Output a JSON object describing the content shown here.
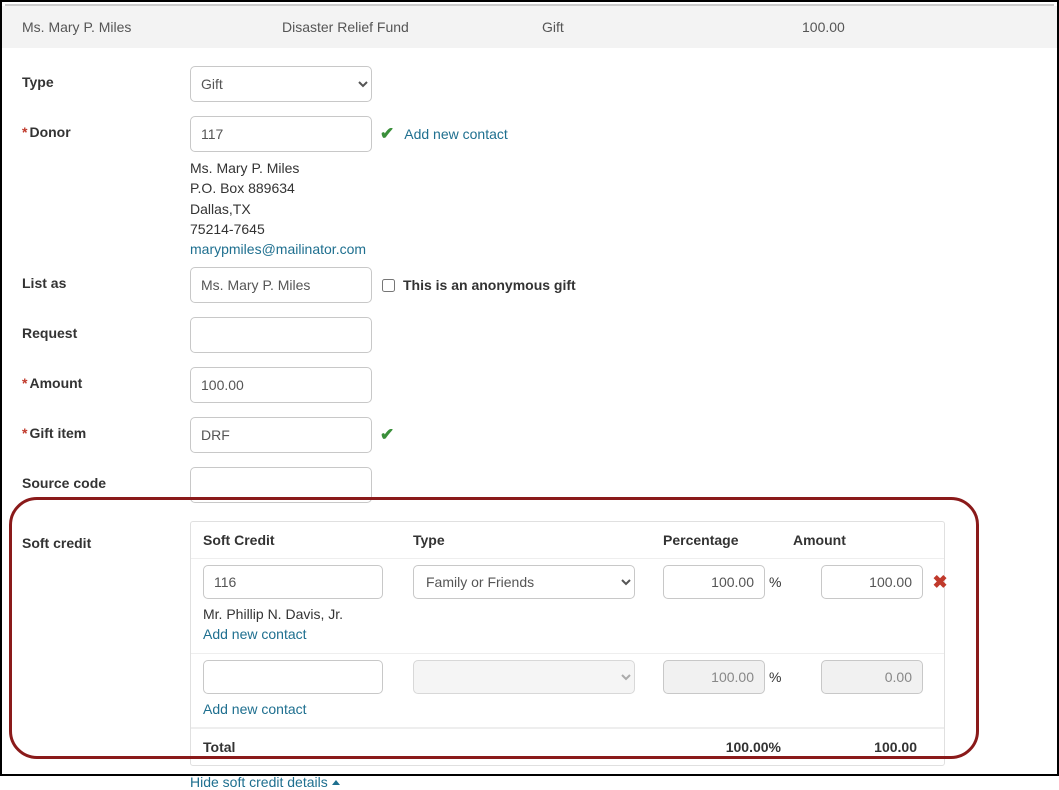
{
  "summary": {
    "name": "Ms. Mary P. Miles",
    "fund": "Disaster Relief Fund",
    "kind": "Gift",
    "amount": "100.00"
  },
  "labels": {
    "type": "Type",
    "donor": "Donor",
    "addContact": "Add new contact",
    "listAs": "List as",
    "anon": "This is an anonymous gift",
    "request": "Request",
    "amount": "Amount",
    "giftItem": "Gift item",
    "sourceCode": "Source code",
    "softCredit": "Soft credit",
    "hideSoftCredit": "Hide soft credit details"
  },
  "fields": {
    "typeValue": "Gift",
    "donorId": "117",
    "listAs": "Ms. Mary P. Miles",
    "request": "",
    "amount": "100.00",
    "giftItem": "DRF",
    "sourceCode": ""
  },
  "donor": {
    "name": "Ms. Mary P. Miles",
    "addr1": "P.O. Box 889634",
    "addr2": "Dallas,TX",
    "zip": "75214-7645",
    "email": "marypmiles@mailinator.com"
  },
  "softCredit": {
    "headers": {
      "sc": "Soft Credit",
      "type": "Type",
      "pct": "Percentage",
      "amt": "Amount"
    },
    "rows": [
      {
        "id": "116",
        "type": "Family or Friends",
        "pct": "100.00",
        "amt": "100.00",
        "contactName": "Mr. Phillip N. Davis, Jr.",
        "disabled": false,
        "deletable": true
      },
      {
        "id": "",
        "type": "",
        "pct": "100.00",
        "amt": "0.00",
        "contactName": "",
        "disabled": true,
        "deletable": false
      }
    ],
    "totals": {
      "label": "Total",
      "pct": "100.00%",
      "amt": "100.00"
    },
    "pctSymbol": "%",
    "addContact": "Add new contact"
  }
}
